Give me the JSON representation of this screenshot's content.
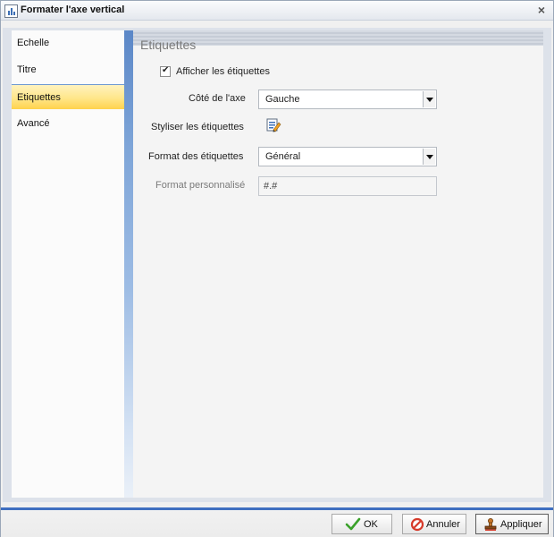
{
  "window": {
    "title": "Formater l'axe vertical",
    "close_glyph": "×"
  },
  "sidebar": {
    "items": [
      {
        "label": "Echelle",
        "selected": false
      },
      {
        "label": "Titre",
        "selected": false
      },
      {
        "label": "Etiquettes",
        "selected": true
      },
      {
        "label": "Avancé",
        "selected": false
      }
    ]
  },
  "panel": {
    "section_title": "Etiquettes",
    "show_labels": {
      "label": "Afficher les étiquettes",
      "checked": true
    },
    "axis_side": {
      "label": "Côté de l'axe",
      "value": "Gauche"
    },
    "style_labels": {
      "label": "Styliser les étiquettes",
      "icon": "style-edit-icon"
    },
    "label_format": {
      "label": "Format des étiquettes",
      "value": "Général"
    },
    "custom_format": {
      "label": "Format personnalisé",
      "value": "#.#"
    }
  },
  "footer": {
    "ok_label": "OK",
    "cancel_label": "Annuler",
    "apply_label": "Appliquer"
  },
  "colors": {
    "accent": "#3f6fc0",
    "selected_item": "#ffe68a",
    "ok_check": "#3aa12a",
    "cancel_icon": "#d63a2a"
  }
}
